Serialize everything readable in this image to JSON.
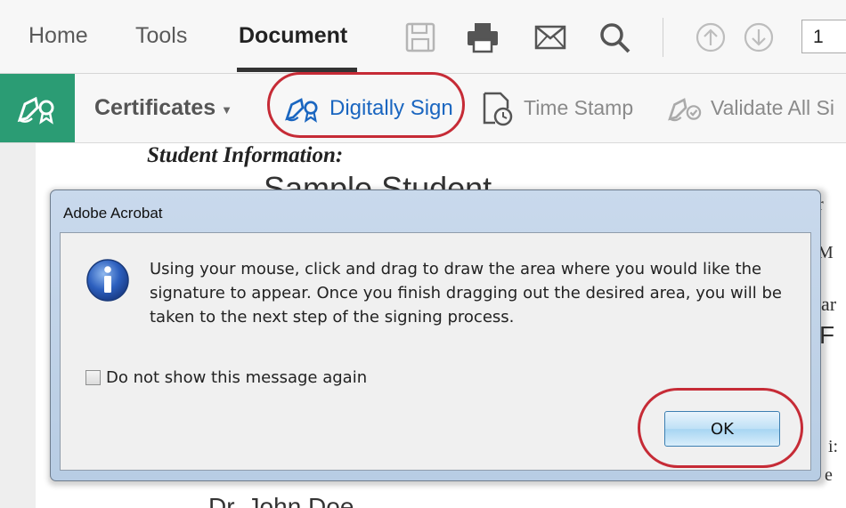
{
  "menu": {
    "tabs": [
      {
        "label": "Home",
        "active": false
      },
      {
        "label": "Tools",
        "active": false
      },
      {
        "label": "Document",
        "active": true
      }
    ],
    "icons": [
      "save-icon",
      "print-icon",
      "email-icon",
      "search-icon",
      "page-up-icon",
      "page-down-icon"
    ],
    "page_number": "1"
  },
  "cert_toolbar": {
    "accent_color": "#2b9c74",
    "certificates_label": "Certificates",
    "digitally_sign_label": "Digitally Sign",
    "time_stamp_label": "Time Stamp",
    "validate_label": "Validate All Si"
  },
  "document": {
    "student_info": "Student Information:",
    "student_name": "Sample Student",
    "doctor_name": "Dr. John Doe",
    "edge_chars": [
      "r",
      "M",
      "ar",
      "F",
      "i:",
      "e"
    ]
  },
  "dialog": {
    "title": "Adobe Acrobat",
    "message": "Using your mouse, click and drag to draw the area where you would like the signature to appear. Once you finish dragging out the desired area, you will be taken to the next step of the signing process.",
    "checkbox_label": "Do not show this message again",
    "checkbox_checked": false,
    "ok_label": "OK"
  },
  "highlight_color": "#c62b36"
}
